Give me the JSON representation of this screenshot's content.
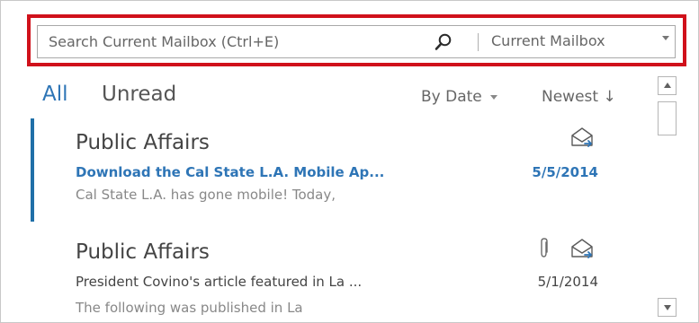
{
  "search": {
    "placeholder": "Search Current Mailbox (Ctrl+E)",
    "value": "",
    "search_icon": "search-icon",
    "scope": "Current Mailbox",
    "scope_icon": "chevron-down-icon"
  },
  "filters": {
    "all_label": "All",
    "unread_label": "Unread",
    "active": "All",
    "sort_label": "By Date",
    "order_label": "Newest ↓"
  },
  "messages": [
    {
      "sender": "Public Affairs",
      "subject": "Download the Cal State L.A. Mobile Ap...",
      "date": "5/5/2014",
      "preview": "Cal State L.A. has gone mobile!  Today,",
      "unread": true,
      "selected": true,
      "icons": [
        "forward-envelope-icon"
      ]
    },
    {
      "sender": "Public Affairs",
      "subject": "President Covino's article featured in La ...",
      "date": "5/1/2014",
      "preview": "The following was published in La",
      "unread": false,
      "selected": false,
      "icons": [
        "paperclip-icon",
        "forward-envelope-icon"
      ]
    }
  ],
  "colors": {
    "accent_blue": "#2e75b6",
    "highlight_red": "#d0111b",
    "selection_bar": "#1f6fa8"
  }
}
